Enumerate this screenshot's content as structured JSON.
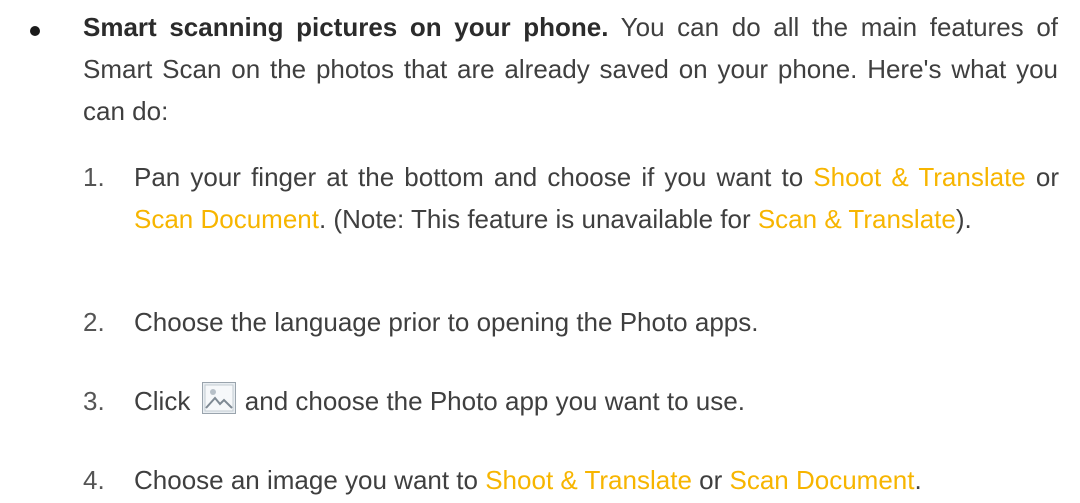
{
  "intro": {
    "lead": "Smart scanning pictures on your phone.",
    "text": " You can do all the main features of Smart Scan on the photos that are already saved on your phone. Here's what you can do:"
  },
  "steps": [
    {
      "number": "1.",
      "parts": {
        "a": "Pan your finger at the bottom and choose if you want to ",
        "b": "Shoot & Translate",
        "c": " or ",
        "d": "Scan Document",
        "e": ". (Note: This feature is unavailable for ",
        "f": "Scan & Translate",
        "g": ")."
      }
    },
    {
      "number": "2.",
      "text": "Choose the language prior to opening the Photo apps."
    },
    {
      "number": "3.",
      "before": "Click ",
      "icon": "photo-gallery-icon",
      "after": " and choose the Photo app you want to use."
    },
    {
      "number": "4.",
      "parts": {
        "a": "Choose an image you want to ",
        "b": "Shoot & Translate",
        "c": " or ",
        "d": "Scan Document",
        "e": "."
      }
    }
  ],
  "colors": {
    "highlight": "#f7b500",
    "body_text": "#3f3f3f"
  }
}
